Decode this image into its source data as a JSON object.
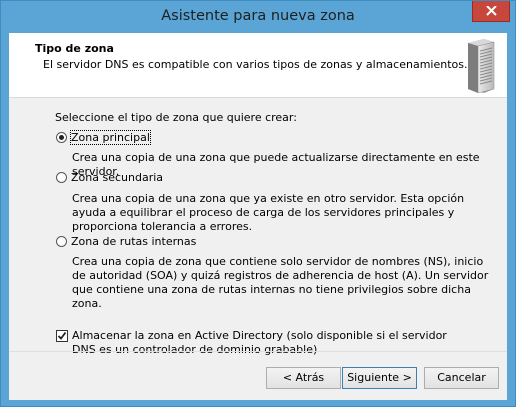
{
  "window": {
    "title": "Asistente para nueva zona"
  },
  "header": {
    "title": "Tipo de zona",
    "subtitle": "El servidor DNS es compatible con varios tipos de zonas y almacenamientos."
  },
  "body": {
    "prompt": "Seleccione el tipo de zona que quiere crear:",
    "options": [
      {
        "label": "Zona principal",
        "selected": true,
        "description": "Crea una copia de una zona que puede actualizarse directamente en este servidor."
      },
      {
        "label": "Zona secundaria",
        "selected": false,
        "description": "Crea una copia de una zona que ya existe en otro servidor. Esta opción ayuda a equilibrar el proceso de carga de los servidores principales y proporciona tolerancia a errores."
      },
      {
        "label": "Zona de rutas internas",
        "selected": false,
        "description": "Crea una copia de zona que contiene solo servidor de nombres (NS), inicio de autoridad (SOA) y quizá registros de adherencia de host (A). Un servidor que contiene una zona de rutas internas no tiene privilegios sobre dicha zona."
      }
    ],
    "store_in_ad": {
      "checked": true,
      "label": "Almacenar la zona en Active Directory (solo disponible si el servidor DNS es un controlador de dominio grabable)"
    }
  },
  "buttons": {
    "back": "< Atrás",
    "next": "Siguiente >",
    "cancel": "Cancelar"
  }
}
